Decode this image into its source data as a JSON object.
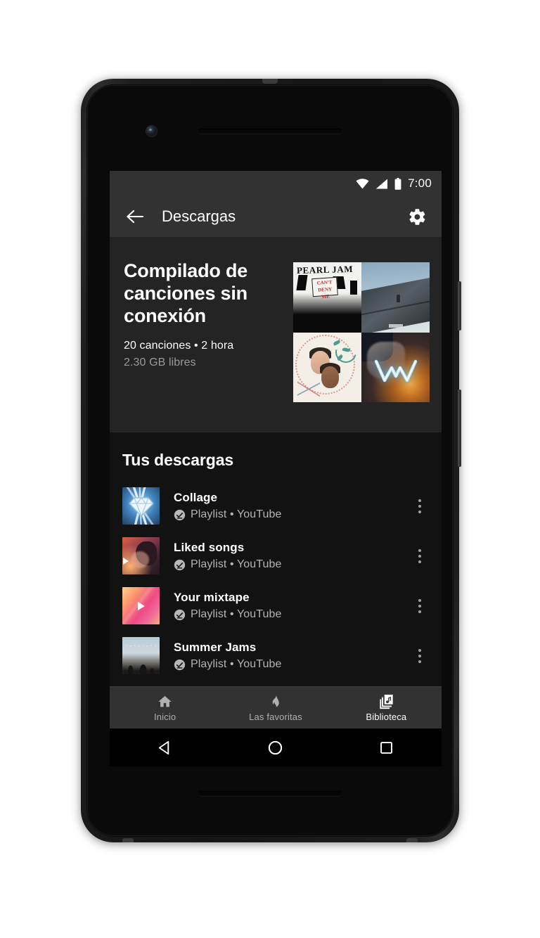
{
  "status_bar": {
    "time": "7:00",
    "icons": [
      "wifi-icon",
      "cellular-signal-icon",
      "battery-icon"
    ]
  },
  "app_bar": {
    "back_icon": "back-arrow-icon",
    "title": "Descargas",
    "settings_icon": "gear-icon"
  },
  "hero": {
    "title": "Compilado de canciones sin conexión",
    "subtitle": "20 canciones • 2 hora",
    "free_space": "2.30 GB libres",
    "artwork": [
      {
        "name": "pearl-jam-cant-deny-me",
        "title_line": "PEARL JAM",
        "sign_line1": "CAN'T",
        "sign_line2": "DENY",
        "sign_line3": "ME"
      },
      {
        "name": "rooftop-blue-sky"
      },
      {
        "name": "illustrated-portrait-wreath"
      },
      {
        "name": "alan-walker-neon-w"
      }
    ]
  },
  "downloads_section": {
    "heading": "Tus descargas",
    "items": [
      {
        "title": "Collage",
        "subtitle": "Playlist • YouTube",
        "thumb": "diamond-art",
        "badge": "downloaded-check-icon",
        "overflow": "more-options-icon"
      },
      {
        "title": "Liked songs",
        "subtitle": "Playlist • YouTube",
        "thumb": "photo-art",
        "badge": "downloaded-check-icon",
        "overflow": "more-options-icon"
      },
      {
        "title": "Your mixtape",
        "subtitle": "Playlist • YouTube",
        "thumb": "mixtape-art",
        "badge": "downloaded-check-icon",
        "overflow": "more-options-icon"
      },
      {
        "title": "Summer Jams",
        "subtitle": "Playlist • YouTube",
        "thumb": "summer-art",
        "badge": "downloaded-check-icon",
        "overflow": "more-options-icon"
      }
    ]
  },
  "bottom_nav": {
    "items": [
      {
        "label": "Inicio",
        "icon": "home-icon",
        "active": false
      },
      {
        "label": "Las favoritas",
        "icon": "flame-icon",
        "active": false
      },
      {
        "label": "Biblioteca",
        "icon": "library-music-icon",
        "active": true
      }
    ]
  },
  "android_nav": {
    "back": "triangle-back-icon",
    "home": "circle-home-icon",
    "recents": "square-recents-icon"
  },
  "colors": {
    "screen_bg": "#121212",
    "hero_bg": "#242424",
    "bar_bg": "#323232",
    "text_primary": "#ffffff",
    "text_secondary": "#b4b4b4",
    "text_tertiary": "#9b9b9b"
  }
}
